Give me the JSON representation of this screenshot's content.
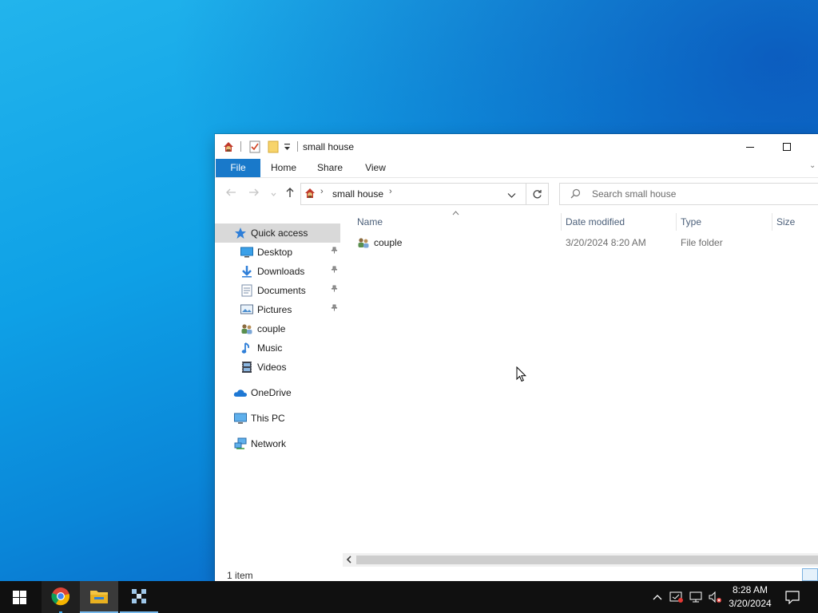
{
  "window": {
    "title": "small house",
    "ribbon_tabs": [
      "File",
      "Home",
      "Share",
      "View"
    ],
    "breadcrumb": "small house",
    "search_placeholder": "Search small house",
    "status_text": "1 item"
  },
  "nav": {
    "quick_access": "Quick access",
    "items": [
      {
        "label": "Desktop",
        "icon": "desktop-icon",
        "pinned": true
      },
      {
        "label": "Downloads",
        "icon": "downloads-icon",
        "pinned": true
      },
      {
        "label": "Documents",
        "icon": "documents-icon",
        "pinned": true
      },
      {
        "label": "Pictures",
        "icon": "pictures-icon",
        "pinned": true
      },
      {
        "label": "couple",
        "icon": "user-folder-icon",
        "pinned": false
      },
      {
        "label": "Music",
        "icon": "music-icon",
        "pinned": false
      },
      {
        "label": "Videos",
        "icon": "videos-icon",
        "pinned": false
      }
    ],
    "onedrive": "OneDrive",
    "this_pc": "This PC",
    "network": "Network"
  },
  "columns": {
    "name": "Name",
    "date": "Date modified",
    "type": "Type",
    "size": "Size"
  },
  "files": [
    {
      "name": "couple",
      "date": "3/20/2024 8:20 AM",
      "type": "File folder",
      "size": ""
    }
  ],
  "taskbar": {
    "time": "8:28 AM",
    "date": "3/20/2024",
    "apps": [
      "chrome-icon",
      "file-explorer-icon",
      "app-icon"
    ]
  },
  "colors": {
    "accent": "#1979ca",
    "selection": "#d9d9d9",
    "taskbar": "#101010"
  }
}
